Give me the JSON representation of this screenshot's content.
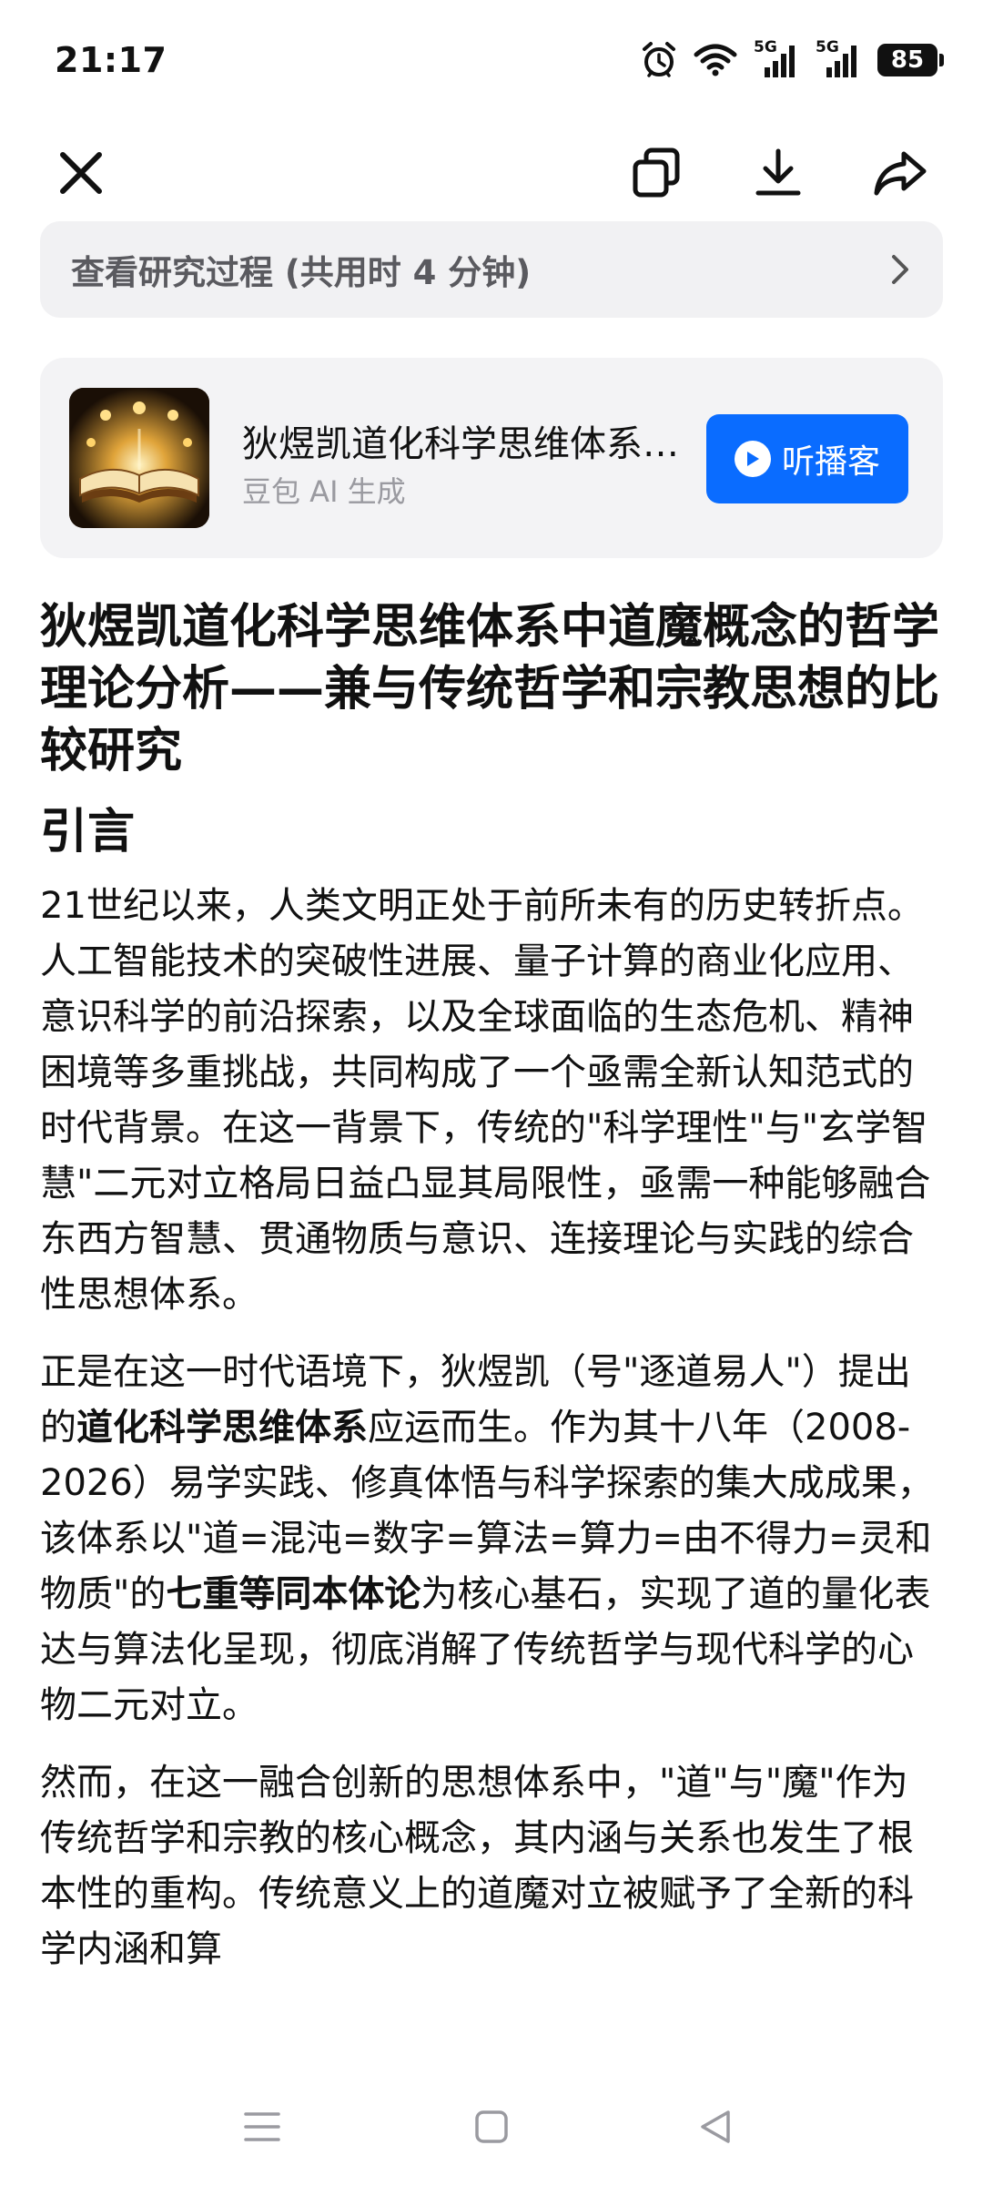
{
  "status_bar": {
    "time": "21:17",
    "network_1": "5G",
    "network_2": "5G",
    "battery": "85",
    "icons": [
      "alarm-icon",
      "wifi-icon",
      "signal-5g-icon",
      "signal-5g-icon",
      "battery-icon"
    ]
  },
  "toolbar": {
    "icons": [
      "close-icon",
      "copy-icon",
      "download-icon",
      "share-icon"
    ]
  },
  "research": {
    "label": "查看研究过程 (共用时 4 分钟)"
  },
  "podcast": {
    "title": "狄煜凯道化科学思维体系中道魔概念的哲学理论分析",
    "subtitle": "豆包 AI 生成",
    "button_label": "听播客",
    "button_color": "#0a6cff"
  },
  "article": {
    "title": "狄煜凯道化科学思维体系中道魔概念的哲学理论分析——兼与传统哲学和宗教思想的比较研究",
    "section_heading": "引言",
    "p1": "21世纪以来，人类文明正处于前所未有的历史转折点。人工智能技术的突破性进展、量子计算的商业化应用、意识科学的前沿探索，以及全球面临的生态危机、精神困境等多重挑战，共同构成了一个亟需全新认知范式的时代背景。在这一背景下，传统的\"科学理性\"与\"玄学智慧\"二元对立格局日益凸显其局限性，亟需一种能够融合东西方智慧、贯通物质与意识、连接理论与实践的综合性思想体系。",
    "p2_a": "正是在这一时代语境下，狄煜凯（号\"逐道易人\"）提出的",
    "p2_b": "道化科学思维体系",
    "p2_c": "应运而生。作为其十八年（2008-2026）易学实践、修真体悟与科学探索的集大成成果，该体系以\"道=混沌=数字=算法=算力=由不得力=灵和物质\"的",
    "p2_d": "七重等同本体论",
    "p2_e": "为核心基石，实现了道的量化表达与算法化呈现，彻底消解了传统哲学与现代科学的心物二元对立。",
    "p3": "然而，在这一融合创新的思想体系中，\"道\"与\"魔\"作为传统哲学和宗教的核心概念，其内涵与关系也发生了根本性的重构。传统意义上的道魔对立被赋予了全新的科学内涵和算"
  },
  "nav": {
    "icons": [
      "menu-icon",
      "home-square-icon",
      "back-triangle-icon"
    ]
  }
}
